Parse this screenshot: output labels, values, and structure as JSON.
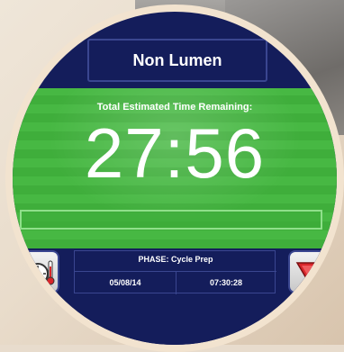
{
  "header": {
    "mode_label": "Non Lumen"
  },
  "timer": {
    "label": "Total Estimated Time Remaining:",
    "value": "27:56"
  },
  "progress": {
    "fraction": 0.0
  },
  "status": {
    "phase": "PHASE: Cycle Prep",
    "date": "05/08/14",
    "time": "07:30:28"
  },
  "icons": {
    "left_button": "gauge-thermometer-icon",
    "right_button": "alert-triangle-icon"
  },
  "colors": {
    "screen_background": "#141d5b",
    "panel_green": "#3fae3b",
    "text": "#ffffff",
    "alert_red": "#d9262a"
  }
}
